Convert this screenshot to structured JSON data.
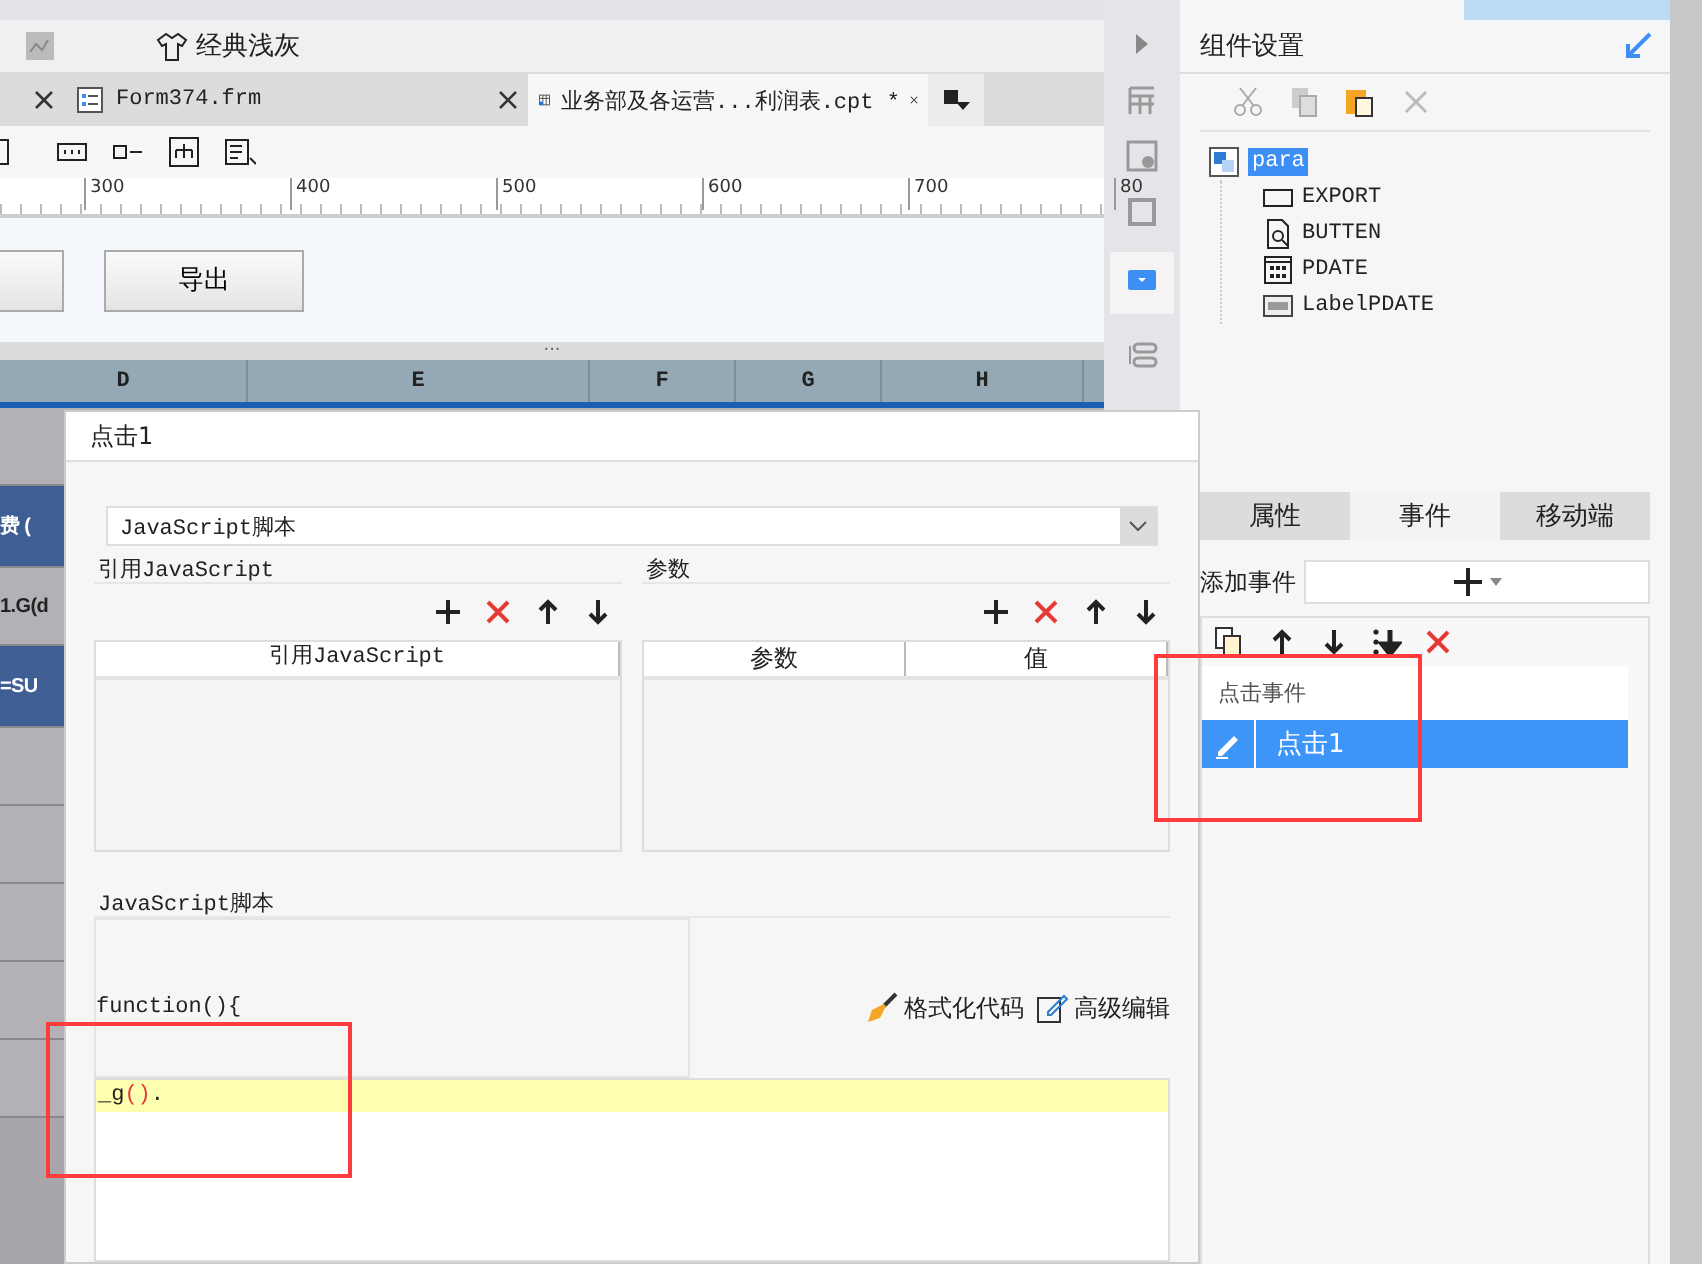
{
  "toolbar": {
    "theme_label": "经典浅灰"
  },
  "file_tabs": [
    {
      "kind": "partial",
      "selected": false
    },
    {
      "label": "Form374.frm",
      "kind": "form",
      "selected": false
    },
    {
      "label": "业务部及各运营...利润表.cpt *",
      "kind": "report",
      "selected": true
    }
  ],
  "ruler": {
    "labels": [
      "300",
      "400",
      "500",
      "600",
      "700",
      "80"
    ]
  },
  "form_area": {
    "buttons": [
      {
        "kind": "partial"
      },
      {
        "kind": "full",
        "label": "导出"
      }
    ]
  },
  "splitter": "...",
  "sheet": {
    "columns": [
      {
        "label": "D"
      },
      {
        "label": "E"
      },
      {
        "label": "F"
      },
      {
        "label": "G"
      },
      {
        "label": "H"
      }
    ],
    "rows": [
      {
        "kind": "gray",
        "text": ""
      },
      {
        "kind": "blue",
        "text": "费 ("
      },
      {
        "kind": "gray",
        "text": "1.G(d"
      },
      {
        "kind": "blue",
        "text": "=SU"
      },
      {
        "kind": "gray",
        "text": ""
      },
      {
        "kind": "gray",
        "text": ""
      },
      {
        "kind": "gray",
        "text": ""
      },
      {
        "kind": "gray",
        "text": ""
      },
      {
        "kind": "gray",
        "text": ""
      }
    ]
  },
  "widget_panel": {
    "title": "组件设置",
    "tree": {
      "label": "para",
      "selected": true,
      "children": [
        {
          "label": "EXPORT",
          "kind": "button",
          "selected": false
        },
        {
          "label": "BUTTEN",
          "kind": "search",
          "selected": false
        },
        {
          "label": "PDATE",
          "kind": "date",
          "selected": false
        },
        {
          "label": "LabelPDATE",
          "kind": "label",
          "selected": false
        }
      ]
    }
  },
  "property_tabs": [
    {
      "label": "属性",
      "selected": false
    },
    {
      "label": "事件",
      "selected": true
    },
    {
      "label": "移动端",
      "selected": false
    }
  ],
  "add_event": {
    "label": "添加事件"
  },
  "event_list": {
    "group": "点击事件",
    "items": [
      {
        "label": "点击1",
        "selected": true
      }
    ]
  },
  "dialog": {
    "title": "点击1",
    "type_select": {
      "value": "JavaScript脚本"
    },
    "ref_section": {
      "title": "引用JavaScript",
      "columns": [
        "引用JavaScript"
      ]
    },
    "param_section": {
      "title": "参数",
      "columns": [
        "参数",
        "值"
      ]
    },
    "script_section": {
      "title": "JavaScript脚本",
      "header_code": "function(){",
      "actions": [
        {
          "label": "格式化代码",
          "kind": "format"
        },
        {
          "label": "高级编辑",
          "kind": "edit"
        }
      ],
      "code_line": [
        {
          "text": "_g",
          "kind": "plain"
        },
        {
          "text": "()",
          "kind": "paren"
        },
        {
          "text": ".",
          "kind": "plain"
        }
      ]
    }
  }
}
